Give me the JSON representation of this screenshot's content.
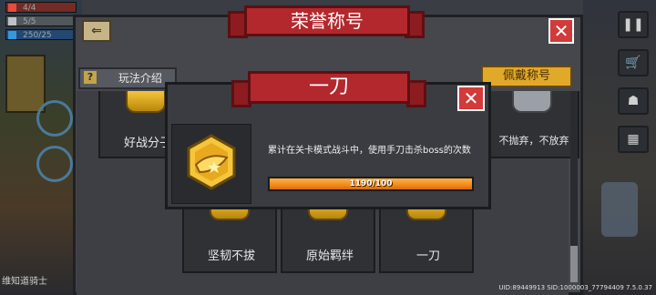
{
  "hud": {
    "health": "4/4",
    "armor": "5/5",
    "energy": "250/25"
  },
  "panel": {
    "title": "荣誉称号",
    "help_label": "玩法介绍",
    "equip_label": "佩戴称号"
  },
  "titles": [
    {
      "label": "好战分子"
    },
    {
      "label": "不抛弃，不放弃"
    },
    {
      "label": "坚韧不拔"
    },
    {
      "label": "原始羁绊"
    },
    {
      "label": "一刀"
    }
  ],
  "popup": {
    "title": "一刀",
    "description": "累计在关卡模式战斗中，使用手刀击杀boss的次数",
    "progress_text": "1190/100",
    "progress_current": 1190,
    "progress_target": 100,
    "progress_fraction": 1.0
  },
  "world": {
    "npc_label": "维知道骑士"
  },
  "footer": {
    "uid_line": "UID:89449913 SID:1000003_77794409 7.5.0.37"
  },
  "colors": {
    "ribbon_red": "#b3282d",
    "close_red": "#d33a3a",
    "progress_orange": "#f28a1c",
    "badge_gold": "#f5c63a",
    "equip_button": "#e0a92a"
  }
}
